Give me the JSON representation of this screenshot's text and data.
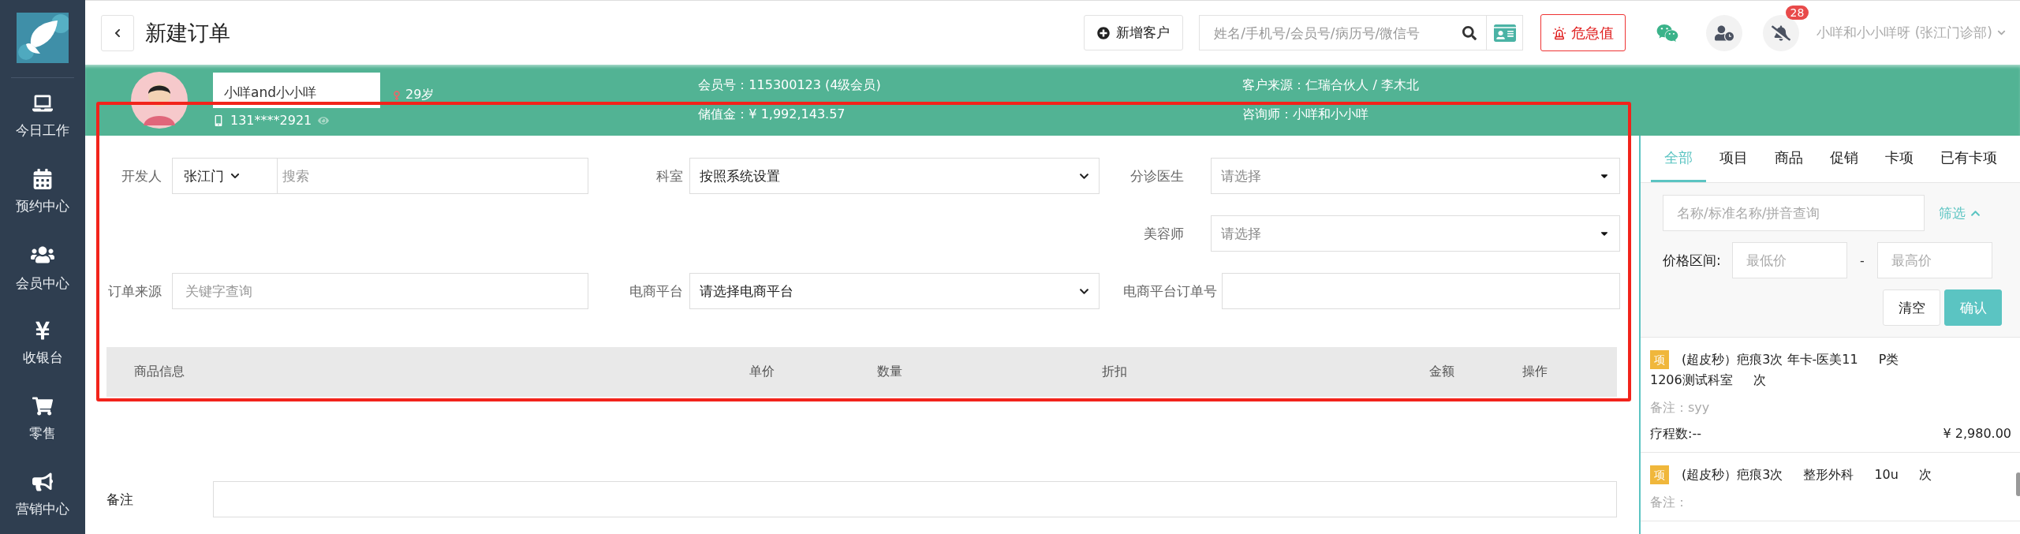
{
  "sidebar": {
    "items": [
      {
        "kind": "laptop",
        "label": "今日工作"
      },
      {
        "kind": "calendar",
        "label": "预约中心"
      },
      {
        "kind": "users",
        "label": "会员中心"
      },
      {
        "kind": "yen",
        "label": "收银台"
      },
      {
        "kind": "cart",
        "label": "零售"
      },
      {
        "kind": "megaphone",
        "label": "营销中心"
      }
    ]
  },
  "header": {
    "title": "新建订单",
    "add_customer": "新增客户",
    "search": {
      "placeholder": "姓名/手机号/会员号/病历号/微信号"
    },
    "alert_button": "危急值",
    "notifications": {
      "badge": "28"
    },
    "user": "小咩和小小咩呀 (张江门诊部)"
  },
  "customer": {
    "name": "小咩and小小咩",
    "age": "29岁",
    "phone": "131****2921",
    "info": [
      {
        "label": "会员号：",
        "value": "115300123 (4级会员)"
      },
      {
        "label": "客户来源：",
        "value": "仁瑞合伙人 / 李木北"
      },
      {
        "label": "储值金：",
        "value": "¥ 1,992,143.57"
      },
      {
        "label": "咨询师：",
        "value": "小咩和小小咩"
      }
    ]
  },
  "form": {
    "rows": [
      [
        {
          "kind": "combo",
          "label": "开发人",
          "value": "张江门",
          "placeholder": "搜索"
        },
        {
          "kind": "select",
          "label": "科室",
          "value": "按照系统设置"
        },
        {
          "kind": "dropdown",
          "label": "分诊医生",
          "placeholder": "请选择"
        }
      ],
      [
        null,
        null,
        {
          "kind": "dropdown",
          "label": "美容师",
          "placeholder": "请选择"
        }
      ],
      [
        {
          "kind": "input",
          "label": "订单来源",
          "placeholder": "关键字查询"
        },
        {
          "kind": "select",
          "label": "电商平台",
          "value": "请选择电商平台"
        },
        {
          "kind": "input",
          "label": "电商平台订单号"
        }
      ]
    ],
    "table": {
      "columns": [
        "商品信息",
        "单价",
        "数量",
        "折扣",
        "金额",
        "操作"
      ]
    },
    "remark": {
      "label": "备注"
    }
  },
  "panel": {
    "tabs": [
      {
        "label": "全部",
        "selected": true
      },
      {
        "label": "项目",
        "selected": false
      },
      {
        "label": "商品",
        "selected": false
      },
      {
        "label": "促销",
        "selected": false
      },
      {
        "label": "卡项",
        "selected": false
      },
      {
        "label": "已有卡项",
        "selected": false
      }
    ],
    "search": {
      "placeholder": "名称/标准名称/拼音查询"
    },
    "filter_toggle": "筛选",
    "price": {
      "label": "价格区间:",
      "min_placeholder": "最低价",
      "separator": "-",
      "max_placeholder": "最高价"
    },
    "buttons": {
      "clear": "清空",
      "confirm": "确认"
    },
    "items": [
      {
        "tag": "项",
        "parts": [
          "(超皮秒）疤痕3次 年卡-医美11",
          "P类",
          "1206测试科室",
          "次"
        ],
        "remark": "备注：syy",
        "sessions": "疗程数:--",
        "price": "¥ 2,980.00"
      },
      {
        "tag": "项",
        "parts": [
          "(超皮秒）疤痕3次",
          "整形外科",
          "10u",
          "次"
        ],
        "remark": "备注："
      }
    ]
  }
}
